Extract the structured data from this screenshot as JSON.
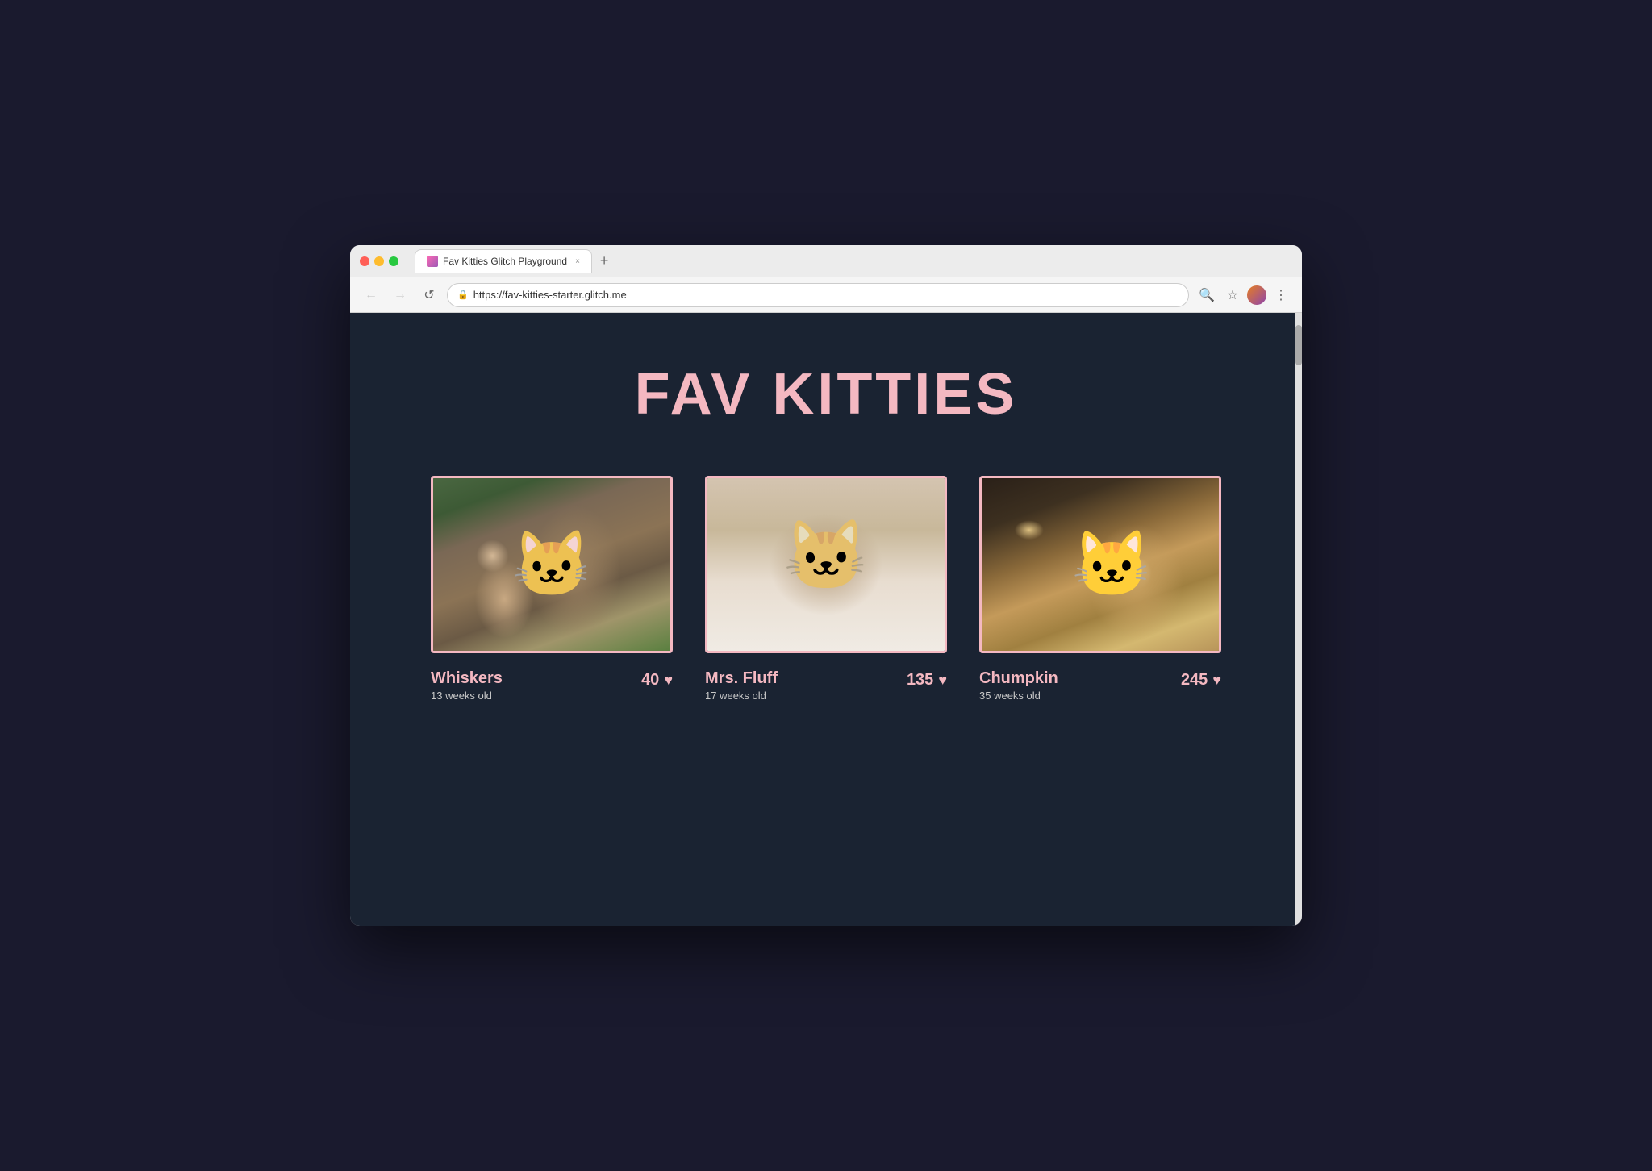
{
  "browser": {
    "tab_title": "Fav Kitties Glitch Playground",
    "tab_close": "×",
    "tab_new": "+",
    "url": "https://fav-kitties-starter.glitch.me",
    "nav": {
      "back": "←",
      "forward": "→",
      "reload": "↺"
    },
    "actions": {
      "search": "🔍",
      "bookmark": "☆",
      "more": "⋮"
    }
  },
  "page": {
    "title": "FAV KITTIES",
    "kitties": [
      {
        "id": "whiskers",
        "name": "Whiskers",
        "age": "13 weeks old",
        "votes": "40",
        "img_class": "cat-whiskers"
      },
      {
        "id": "mrs-fluff",
        "name": "Mrs. Fluff",
        "age": "17 weeks old",
        "votes": "135",
        "img_class": "cat-fluff"
      },
      {
        "id": "chumpkin",
        "name": "Chumpkin",
        "age": "35 weeks old",
        "votes": "245",
        "img_class": "cat-chumpkin"
      }
    ]
  },
  "colors": {
    "bg": "#1a2332",
    "accent": "#f4b8c1",
    "text_secondary": "#c8c8c8"
  }
}
